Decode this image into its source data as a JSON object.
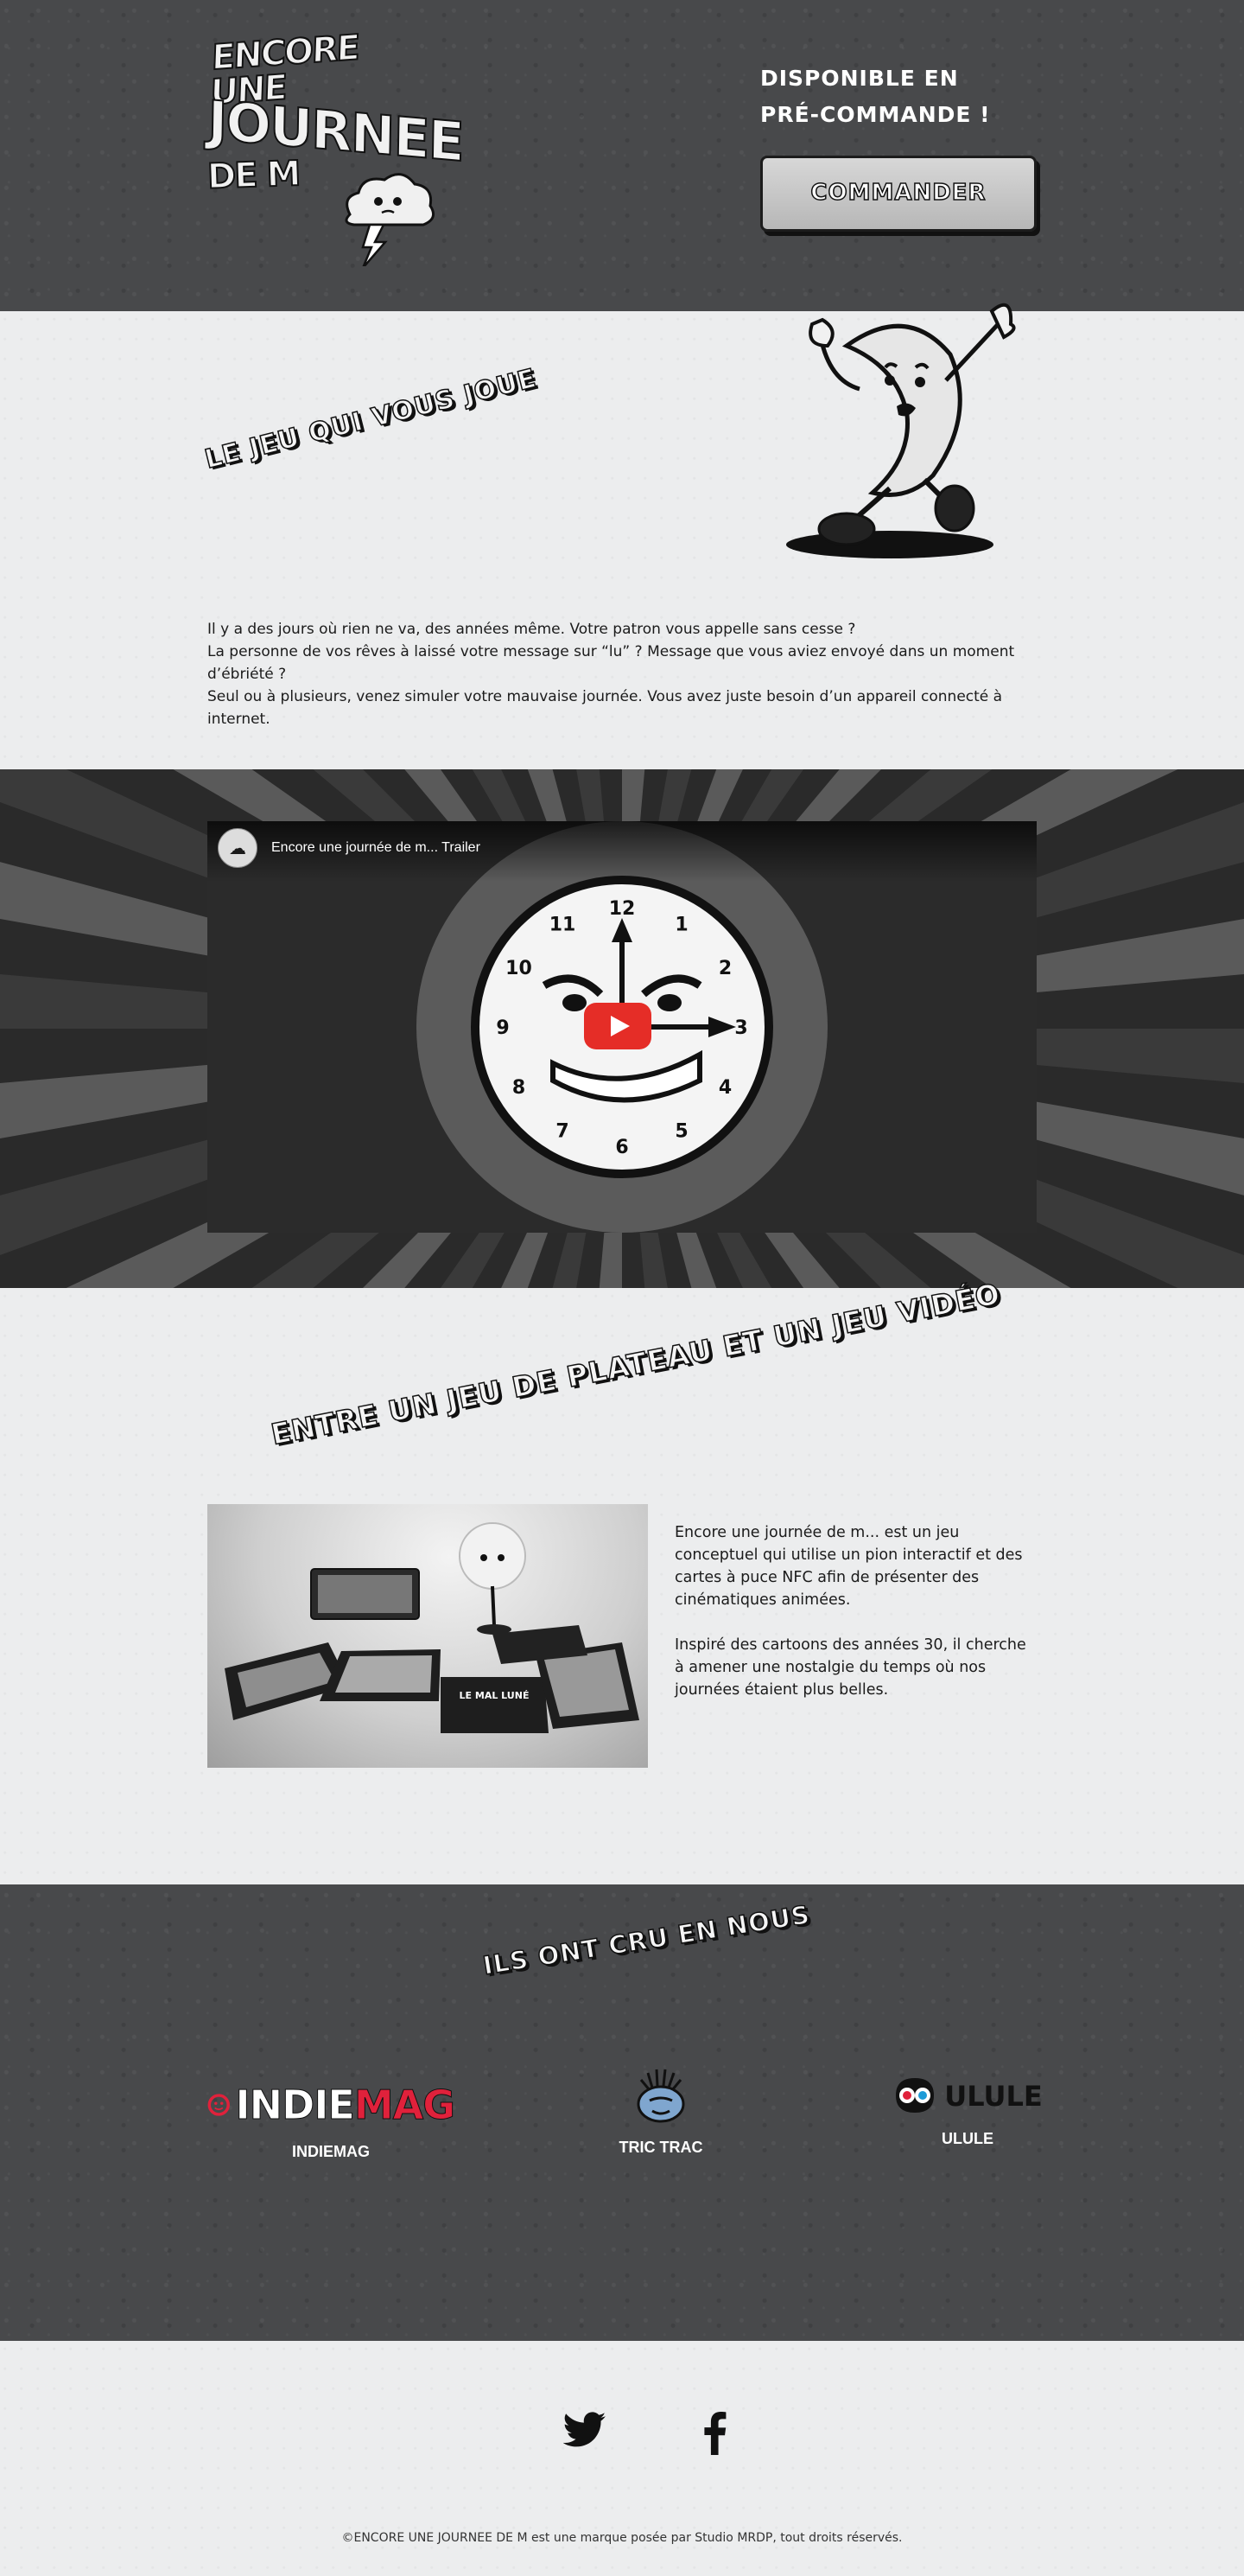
{
  "header": {
    "logo_lines": [
      "ENCORE UNE",
      "JOURNEE",
      "DE"
    ],
    "logo_fragment": "M",
    "preorder_line1": "DISPONIBLE EN",
    "preorder_line2": "PRÉ-COMMANDE !",
    "cta_label": "COMMANDER"
  },
  "intro": {
    "title": "LE JEU QUI VOUS JOUE",
    "paragraph_lines": [
      "Il y a des jours où rien ne va, des années même. Votre patron vous appelle sans cesse ?",
      "La personne de vos rêves à laissé votre message sur “lu” ? Message que vous aviez envoyé dans un moment d’ébriété ?",
      "Seul ou à plusieurs, venez simuler votre mauvaise journée. Vous avez juste besoin d’un appareil connecté à internet."
    ]
  },
  "video": {
    "title": "Encore une journée de m... Trailer",
    "clock_numbers": [
      "12",
      "1",
      "2",
      "3",
      "4",
      "5",
      "6",
      "7",
      "8",
      "9",
      "10",
      "11"
    ]
  },
  "board": {
    "title": "ENTRE UN JEU DE PLATEAU ET UN JEU VIDÉO",
    "paragraph1": "Encore une journée de m... est un jeu conceptuel qui utilise un pion interactif et des cartes à puce NFC afin de présenter des cinématiques animées.",
    "paragraph2": "Inspiré des cartoons des années 30, il cherche à amener une nostalgie du temps où nos journées étaient plus belles.",
    "card_label": "LE MAL LUNÉ"
  },
  "partners": {
    "title": "ILS ONT CRU EN NOUS",
    "items": [
      {
        "name": "INDIEMAG",
        "logo_white": "INDIE",
        "logo_red": "MAG"
      },
      {
        "name": "TRIC TRAC"
      },
      {
        "name": "ULULE",
        "logo_word": "ULULE"
      }
    ]
  },
  "footer": {
    "copyright": "©ENCORE UNE JOURNEE DE M  est une marque posée par Studio MRDP, tout droits réservés."
  },
  "colors": {
    "dark_bg": "#48494b",
    "light_bg": "#ecedee",
    "indiemag_red": "#e0213b",
    "youtube_red": "#e52d27"
  },
  "icons": [
    "twitter-icon",
    "facebook-icon",
    "youtube-play-icon",
    "lightning-icon",
    "cloud-icon"
  ]
}
